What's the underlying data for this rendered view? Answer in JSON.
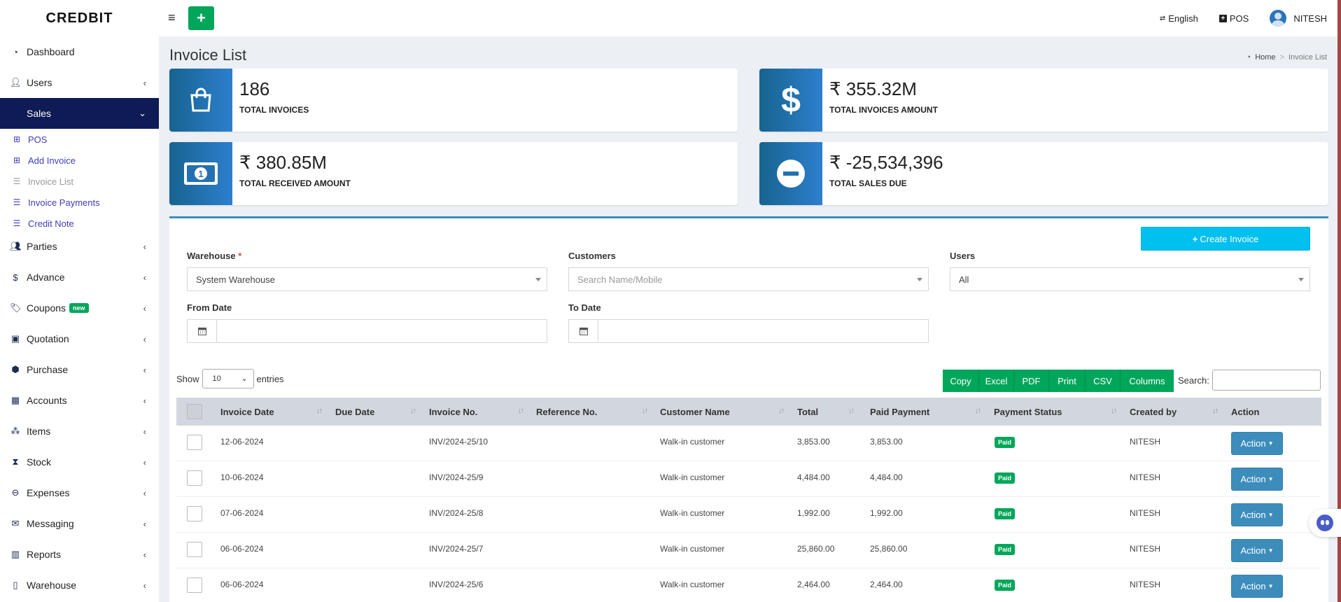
{
  "app": {
    "brand": "CREDBIT"
  },
  "topbar": {
    "language": "English",
    "pos": "POS",
    "user": "NITESH"
  },
  "sidebar": {
    "items": [
      {
        "label": "Dashboard",
        "icon": "dashboard-icon"
      },
      {
        "label": "Users",
        "icon": "user-plus-icon"
      },
      {
        "label": "Sales",
        "icon": "",
        "active": true
      },
      {
        "label": "Parties",
        "icon": "users-icon"
      },
      {
        "label": "Advance",
        "icon": "dollar-icon"
      },
      {
        "label": "Coupons",
        "icon": "tags-icon",
        "badge": "new"
      },
      {
        "label": "Quotation",
        "icon": "calendar-plus-icon"
      },
      {
        "label": "Purchase",
        "icon": "cube-icon"
      },
      {
        "label": "Accounts",
        "icon": "grid-icon"
      },
      {
        "label": "Items",
        "icon": "cubes-icon"
      },
      {
        "label": "Stock",
        "icon": "hourglass-icon"
      },
      {
        "label": "Expenses",
        "icon": "minus-circle-icon"
      },
      {
        "label": "Messaging",
        "icon": "envelope-icon"
      },
      {
        "label": "Reports",
        "icon": "bar-chart-icon"
      },
      {
        "label": "Warehouse",
        "icon": "building-icon"
      }
    ],
    "sales_sub": [
      {
        "label": "POS",
        "icon": "plus-square-icon"
      },
      {
        "label": "Add Invoice",
        "icon": "plus-square-icon"
      },
      {
        "label": "Invoice List",
        "icon": "list-icon"
      },
      {
        "label": "Invoice Payments",
        "icon": "list-icon"
      },
      {
        "label": "Credit Note",
        "icon": "list-icon"
      }
    ]
  },
  "page": {
    "title": "Invoice List",
    "breadcrumb": {
      "home": "Home",
      "current": "Invoice List"
    }
  },
  "stats": [
    {
      "value": "186",
      "label": "TOTAL INVOICES",
      "icon": "shopping-bag-icon"
    },
    {
      "value": "₹ 355.32M",
      "label": "TOTAL INVOICES AMOUNT",
      "icon": "dollar-icon"
    },
    {
      "value": "₹ 380.85M",
      "label": "TOTAL RECEIVED AMOUNT",
      "icon": "money-bill-icon"
    },
    {
      "value": "₹ -25,534,396",
      "label": "TOTAL SALES DUE",
      "icon": "minus-circle-icon"
    }
  ],
  "filters": {
    "create_button": "Create Invoice",
    "warehouse_label": "Warehouse",
    "warehouse_required": "*",
    "warehouse_value": "System Warehouse",
    "customers_label": "Customers",
    "customers_placeholder": "Search Name/Mobile",
    "users_label": "Users",
    "users_value": "All",
    "from_date_label": "From Date",
    "to_date_label": "To Date"
  },
  "table_controls": {
    "show": "Show",
    "entries_value": "10",
    "entries": "entries",
    "buttons": [
      "Copy",
      "Excel",
      "PDF",
      "Print",
      "CSV",
      "Columns"
    ],
    "search_label": "Search:"
  },
  "table": {
    "columns": [
      "Invoice Date",
      "Due Date",
      "Invoice No.",
      "Reference No.",
      "Customer Name",
      "Total",
      "Paid Payment",
      "Payment Status",
      "Created by",
      "Action"
    ],
    "rows": [
      {
        "invoice_date": "12-06-2024",
        "due_date": "",
        "invoice_no": "INV/2024-25/10",
        "reference_no": "",
        "customer": "Walk-in customer",
        "total": "3,853.00",
        "paid": "3,853.00",
        "status": "Paid",
        "created_by": "NITESH",
        "action": "Action"
      },
      {
        "invoice_date": "10-06-2024",
        "due_date": "",
        "invoice_no": "INV/2024-25/9",
        "reference_no": "",
        "customer": "Walk-in customer",
        "total": "4,484.00",
        "paid": "4,484.00",
        "status": "Paid",
        "created_by": "NITESH",
        "action": "Action"
      },
      {
        "invoice_date": "07-06-2024",
        "due_date": "",
        "invoice_no": "INV/2024-25/8",
        "reference_no": "",
        "customer": "Walk-in customer",
        "total": "1,992.00",
        "paid": "1,992.00",
        "status": "Paid",
        "created_by": "NITESH",
        "action": "Action"
      },
      {
        "invoice_date": "06-06-2024",
        "due_date": "",
        "invoice_no": "INV/2024-25/7",
        "reference_no": "",
        "customer": "Walk-in customer",
        "total": "25,860.00",
        "paid": "25,860.00",
        "status": "Paid",
        "created_by": "NITESH",
        "action": "Action"
      },
      {
        "invoice_date": "06-06-2024",
        "due_date": "",
        "invoice_no": "INV/2024-25/6",
        "reference_no": "",
        "customer": "Walk-in customer",
        "total": "2,464.00",
        "paid": "2,464.00",
        "status": "Paid",
        "created_by": "NITESH",
        "action": "Action"
      }
    ]
  },
  "colors": {
    "sidebar_active": "#0e1b54",
    "green": "#00a65a",
    "cyan": "#00c0ef",
    "blue": "#3c8dbc"
  }
}
